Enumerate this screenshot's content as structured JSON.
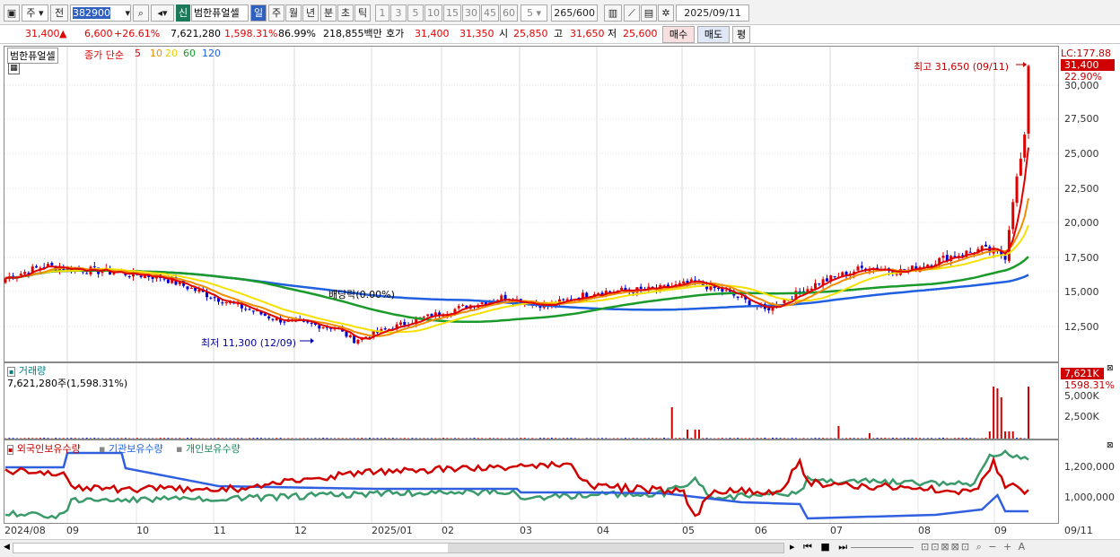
{
  "toolbar": {
    "market": "주",
    "prev": "전",
    "code": "382900",
    "new_badge": "신",
    "stock_name": "범한퓨얼셀",
    "periods": [
      "일",
      "주",
      "월",
      "년",
      "분",
      "초",
      "틱"
    ],
    "intervals": [
      "1",
      "3",
      "5",
      "10",
      "15",
      "30",
      "45",
      "60"
    ],
    "count_select": "5",
    "bars": "265",
    "bars_max": "/600",
    "date": "2025/09/11"
  },
  "quote": {
    "price": "31,400",
    "arrow": "▲",
    "change": "6,600",
    "change_pct": "+26.61%",
    "volume": "7,621,280",
    "vol_pct": "1,598.31%",
    "turnover": "86.99%",
    "amount": "218,855백만",
    "hoga": "호가",
    "hoga_ask": "31,400",
    "hoga_bid": "31,350",
    "open_lbl": "시",
    "open": "25,850",
    "high_lbl": "고",
    "high": "31,650",
    "low_lbl": "저",
    "low": "25,600",
    "buy": "매수",
    "sell": "매도",
    "avg": "평"
  },
  "price_pane": {
    "title": "범한퓨얼셀",
    "ma_title": "종가 단순",
    "ma_periods": [
      "5",
      "10",
      "20",
      "60",
      "120"
    ],
    "high_note": "최고 31,650 (09/11)",
    "low_note": "최저 11,300 (12/09)",
    "dividend_note": "배당락(0.00%)",
    "lc": "LC:177.88",
    "last_price": "31,400",
    "last_pct": "22.90%",
    "y_ticks": [
      "30,000",
      "27,500",
      "25,000",
      "22,500",
      "20,000",
      "17,500",
      "15,000",
      "12,500"
    ]
  },
  "volume_pane": {
    "title": "거래량",
    "value": "7,621,280주(1,598.31%)",
    "last": "7,621K",
    "last_pct": "1598.31%",
    "y_ticks": [
      "5,000K",
      "2,500K"
    ]
  },
  "holdings_pane": {
    "foreign": "외국인보유수량",
    "inst": "기관보유수량",
    "indiv": "개인보유수량",
    "y_ticks": [
      "1,200,000",
      "1,000,000"
    ]
  },
  "x_axis": [
    "2024/08",
    "09",
    "10",
    "11",
    "12",
    "2025/01",
    "02",
    "03",
    "04",
    "05",
    "06",
    "07",
    "08",
    "09",
    "09/11"
  ],
  "colors": {
    "up": "#e00000",
    "down": "#0000d0",
    "ma5": "#e00000",
    "ma10": "#f08c00",
    "ma20": "#f5e000",
    "ma60": "#1a9a2a",
    "ma120": "#2060e0"
  }
}
